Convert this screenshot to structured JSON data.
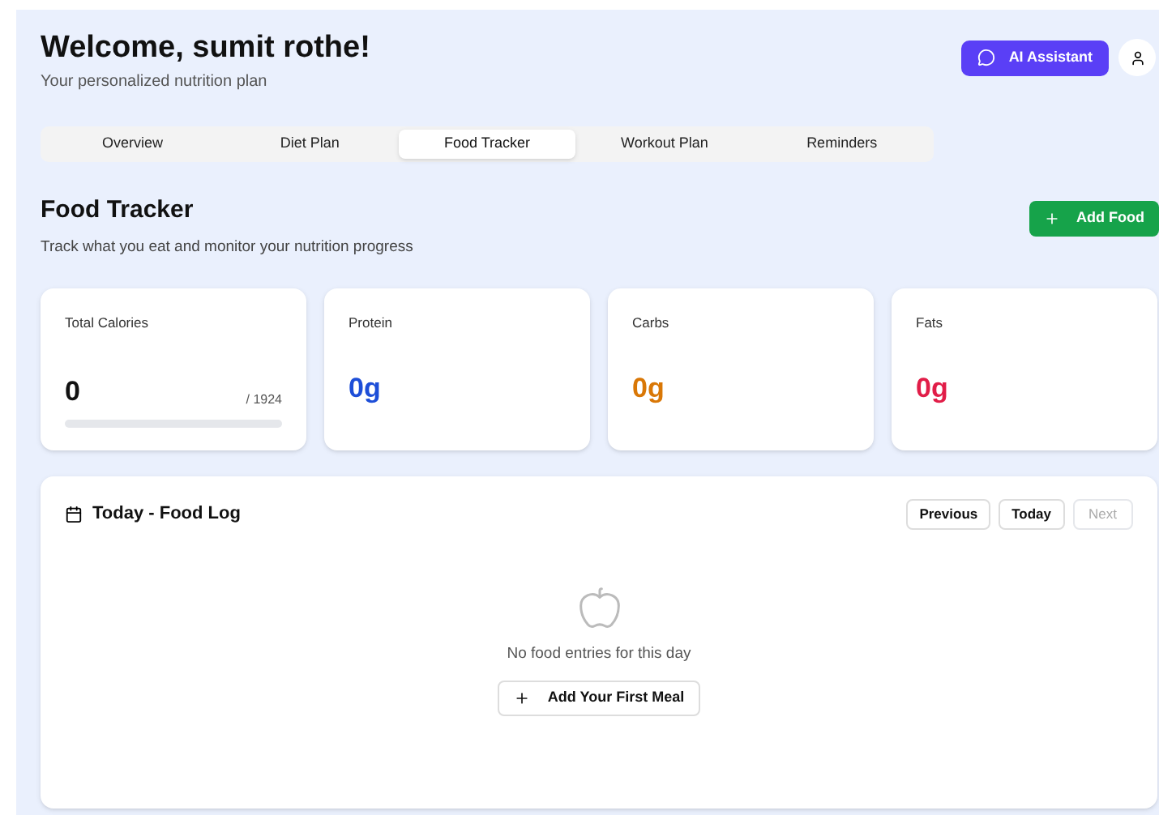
{
  "header": {
    "title": "Welcome, sumit rothe!",
    "subtitle": "Your personalized nutrition plan",
    "assistant_button": "AI Assistant"
  },
  "tabs": [
    {
      "label": "Overview",
      "selected": false
    },
    {
      "label": "Diet Plan",
      "selected": false
    },
    {
      "label": "Food Tracker",
      "selected": true
    },
    {
      "label": "Workout Plan",
      "selected": false
    },
    {
      "label": "Reminders",
      "selected": false
    }
  ],
  "section": {
    "title": "Food Tracker",
    "description": "Track what you eat and monitor your nutrition progress",
    "add_button": "Add Food"
  },
  "stats": [
    {
      "kind": "progress",
      "label": "Total Calories",
      "value": "0",
      "target": "/ 1924",
      "level": 0
    },
    {
      "kind": "macro",
      "label": "Protein",
      "value": "0g",
      "color": "#1d4ed8"
    },
    {
      "kind": "macro",
      "label": "Carbs",
      "value": "0g",
      "color": "#d97706"
    },
    {
      "kind": "macro",
      "label": "Fats",
      "value": "0g",
      "color": "#e11d48"
    }
  ],
  "food_log": {
    "title": "Today - Food Log",
    "nav": [
      {
        "label": "Previous",
        "disabled": false
      },
      {
        "label": "Today",
        "disabled": false
      },
      {
        "label": "Next",
        "disabled": true
      }
    ],
    "empty_message": "No food entries for this day",
    "add_button": "Add Your First Meal"
  }
}
